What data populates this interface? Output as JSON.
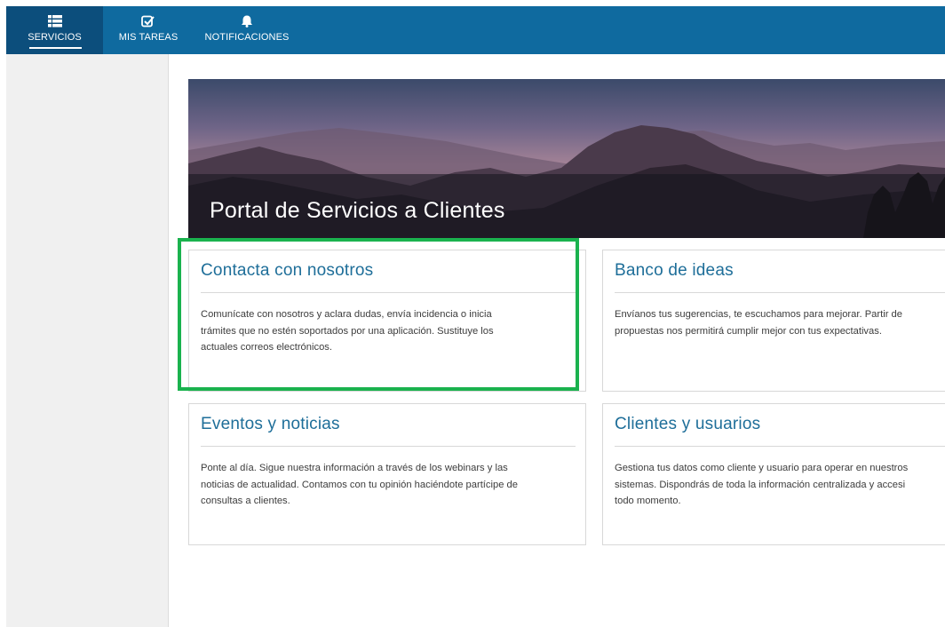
{
  "nav": {
    "items": [
      {
        "label": "SERVICIOS",
        "icon": "list-icon",
        "active": true
      },
      {
        "label": "MIS TAREAS",
        "icon": "checkbox-icon",
        "active": false
      },
      {
        "label": "NOTIFICACIONES",
        "icon": "bell-icon",
        "active": false
      }
    ]
  },
  "hero": {
    "title": "Portal de Servicios a Clientes"
  },
  "cards": [
    {
      "title": "Contacta con nosotros",
      "lines": [
        "Comunícate con nosotros y aclara dudas, envía incidencia o inicia",
        "trámites que no estén soportados por una aplicación. Sustituye los",
        "actuales correos electrónicos."
      ]
    },
    {
      "title": "Banco de ideas",
      "lines": [
        "Envíanos tus sugerencias, te escuchamos para mejorar. Partir de",
        "propuestas nos permitirá cumplir mejor con tus expectativas."
      ]
    },
    {
      "title": "Eventos y noticias",
      "lines": [
        "Ponte al día. Sigue nuestra información a través de los webinars y las",
        "noticias de actualidad. Contamos con tu opinión haciéndote partícipe de",
        "consultas a clientes."
      ]
    },
    {
      "title": "Clientes y usuarios",
      "lines": [
        "Gestiona tus datos como cliente y usuario para operar en nuestros",
        "sistemas. Dispondrás de toda la información centralizada y accesi",
        "todo momento."
      ]
    }
  ],
  "colors": {
    "navbar": "#0f6a9f",
    "nav_active": "#0c4e7c",
    "card_title": "#1e6e99",
    "highlight": "#1ab24e"
  }
}
